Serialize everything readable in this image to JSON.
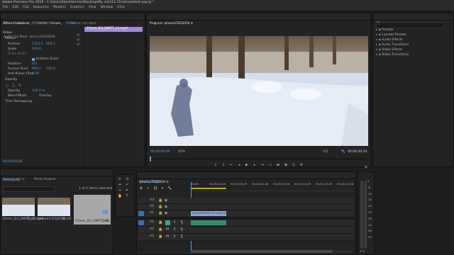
{
  "app": {
    "title": "Adobe Premiere Pro 2019 - C:\\Users\\StyleHomme\\Desktop\\My vids\\12.Christmas\\test.prproj *"
  },
  "menu": [
    "File",
    "Edit",
    "Clip",
    "Sequence",
    "Markers",
    "Graphics",
    "View",
    "Window",
    "Help"
  ],
  "source_panel": {
    "tabs": [
      "Effect Controls ≡",
      "Lumetri Scopes",
      "Source: (no clips)",
      "Audio Clip Mixer: iphone1FEQ2019"
    ],
    "clip_path": "Master * iphone1_FEQ2019 * 15mm_...",
    "mini_time": "00;00",
    "clip_label": "15mm_D3_DWTT_v1.mp4",
    "section_video": "Video",
    "section_motion": "Motion",
    "props": [
      {
        "name": "Position",
        "v1": "1553.5",
        "v2": "900.5"
      },
      {
        "name": "Scale",
        "v1": "100.0",
        "v2": ""
      },
      {
        "name": "Scale Width",
        "v1": "",
        "v2": ""
      },
      {
        "name": "Uniform Scale",
        "v1": "",
        "v2": ""
      },
      {
        "name": "Rotation",
        "v1": "0.0",
        "v2": ""
      },
      {
        "name": "Anchor Point",
        "v1": "960.0",
        "v2": "540.0"
      },
      {
        "name": "Anti-flicker Filter",
        "v1": "0.00",
        "v2": ""
      }
    ],
    "opacity_section": "Opacity",
    "opacity_label": "Opacity",
    "opacity_value": "100.0 %",
    "blend_label": "Blend Mode",
    "blend_value": "Overlay",
    "time_remap": "Time Remapping",
    "footer_time": "00;00;00;00"
  },
  "program": {
    "tab": "Program: iphone1FEQ2019 ≡",
    "timecode": "00;00;00;00",
    "zoom": "25%",
    "resolution": "1/2",
    "duration": "00;00;30;20"
  },
  "effects": {
    "tab": "Effects ≡",
    "search_placeholder": "",
    "items": [
      "Presets",
      "Lumetri Presets",
      "Audio Effects",
      "Audio Transitions",
      "Video Effects",
      "Video Transitions"
    ]
  },
  "project": {
    "tabs": [
      "Project: test ≡",
      "Media Browser"
    ],
    "folder": "test.prproj",
    "count": "1 of 2 items selected",
    "items": [
      {
        "name": "15mm_D3_DWTT_v1.mp4",
        "dur": "30;20"
      },
      {
        "name": "iphone1FEQ2019",
        "dur": "30;20"
      },
      {
        "name": "15mm_D3_DWTT_v1...",
        "dur": "0:00"
      }
    ]
  },
  "timeline": {
    "tab": "iphone1FEQ2019 ≡",
    "timecode": "00;00;00;00",
    "ruler": [
      "00;00",
      "00;00;14;29",
      "00;00;29;29",
      "00;00;44;28",
      "00;00;59;28",
      "00;01;14;29",
      "00;01;29;29",
      "00;01;44;28",
      "00;01;59;28"
    ],
    "video_tracks": [
      "V3",
      "V2",
      "V1"
    ],
    "audio_tracks": [
      "A1",
      "A2",
      "A3"
    ],
    "clip_label": "iphone1FEQ2019.mp4 [V]",
    "audio_clip_label": ""
  },
  "meter": {
    "labels": [
      "0",
      "-6",
      "-12",
      "-18",
      "-24",
      "-30",
      "-36",
      "-42",
      "-48",
      "-54"
    ],
    "bottom": "S S"
  },
  "colors": {
    "accent": "#5b9be0",
    "selection_purple": "#9f8ad6",
    "clip_video": "#8ea6d6",
    "clip_audio": "#2f8f6e"
  }
}
